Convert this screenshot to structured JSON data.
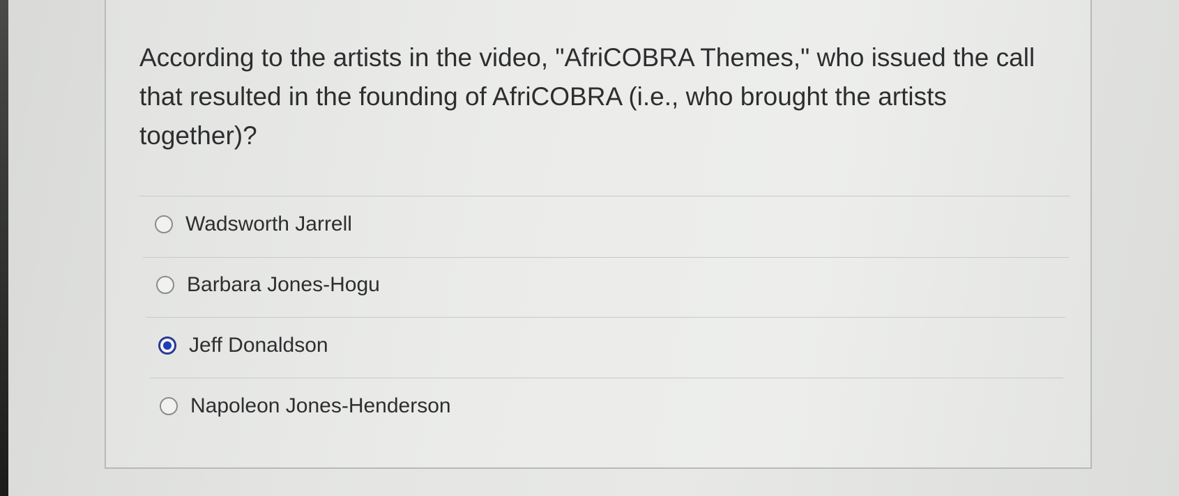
{
  "question": {
    "text": "According to the artists in the video, \"AfriCOBRA Themes,\" who issued the call that resulted in the founding of AfriCOBRA (i.e., who brought the artists together)?"
  },
  "answers": [
    {
      "label": "Wadsworth Jarrell",
      "selected": false
    },
    {
      "label": "Barbara Jones-Hogu",
      "selected": false
    },
    {
      "label": "Jeff Donaldson",
      "selected": true
    },
    {
      "label": "Napoleon Jones-Henderson",
      "selected": false
    }
  ],
  "colors": {
    "selected_radio": "#1f3fb8",
    "text": "#2d2e2f"
  }
}
